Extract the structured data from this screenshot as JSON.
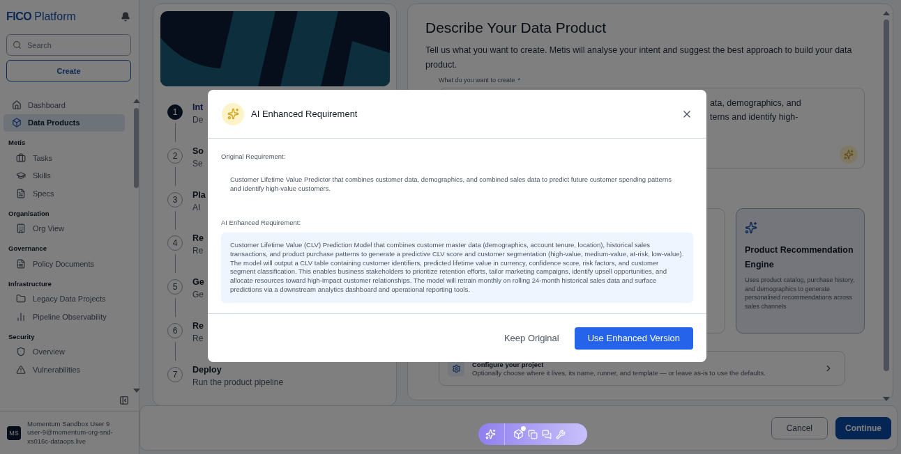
{
  "sidebar": {
    "logo": {
      "brand": "FICO",
      "product": "Platform"
    },
    "search": {
      "placeholder": "Search"
    },
    "create_button": "Create",
    "sections": [
      {
        "items": [
          {
            "label": "Dashboard",
            "selected": false
          },
          {
            "label": "Data Products",
            "selected": true
          }
        ]
      },
      {
        "heading": "Metis",
        "items": [
          {
            "label": "Tasks",
            "selected": false
          },
          {
            "label": "Skills",
            "selected": false
          },
          {
            "label": "Specs",
            "selected": false
          }
        ]
      },
      {
        "heading": "Organisation",
        "items": [
          {
            "label": "Org View",
            "selected": false
          }
        ]
      },
      {
        "heading": "Governance",
        "items": [
          {
            "label": "Policy Documents",
            "selected": false
          }
        ]
      },
      {
        "heading": "Infrastructure",
        "items": [
          {
            "label": "Legacy Data Projects",
            "selected": false
          },
          {
            "label": "Pipeline Observability",
            "selected": false
          }
        ]
      },
      {
        "heading": "Security",
        "items": [
          {
            "label": "Overview",
            "selected": false
          },
          {
            "label": "Vulnerabilities",
            "selected": false
          }
        ]
      }
    ],
    "user": {
      "initials": "MS",
      "name": "Momentum Sandbox User 9",
      "email": "user-9@momentum-org-snd-xs016c-dataops.live"
    }
  },
  "steps": [
    {
      "number": "1",
      "title": "Int",
      "subtitle": "De",
      "selected": true
    },
    {
      "number": "2",
      "title": "So",
      "subtitle": "Se",
      "selected": false
    },
    {
      "number": "3",
      "title": "Pla",
      "subtitle": "AI",
      "selected": false
    },
    {
      "number": "4",
      "title": "Re",
      "subtitle": "Re",
      "selected": false
    },
    {
      "number": "5",
      "title": "Ge",
      "subtitle": "Ge",
      "selected": false
    },
    {
      "number": "6",
      "title": "Re",
      "subtitle": "Re",
      "selected": false
    },
    {
      "number": "7",
      "title": "Deploy",
      "subtitle": "Run the product pipeline",
      "selected": false
    }
  ],
  "page": {
    "title": "Describe Your Data Product",
    "description": "Tell us what you want to create. Metis will analyse your intent and suggest the best approach to build your data product.",
    "field": {
      "label": "What do you want to create",
      "required_mark": "*",
      "visible_lines": [
        "ata, demographics, and",
        "terns and identify high-"
      ]
    },
    "cards": [
      {
        "title": "Product Recommendation Engine",
        "description": "Uses product catalog, purchase history, and demographics to generate personalised recommendations across sales channels"
      }
    ],
    "configure": {
      "title": "Configure your project",
      "description": "Optionally choose where it lives, its name, runner, and template — or leave as-is to use the defaults."
    }
  },
  "footer": {
    "buttons": [
      {
        "label": "Cancel",
        "kind": "secondary"
      },
      {
        "label": "Continue",
        "kind": "primary"
      }
    ]
  },
  "modal": {
    "title": "AI Enhanced Requirement",
    "sections": [
      {
        "kind": "plain",
        "label": "Original Requirement:",
        "text": "Customer Lifetime Value Predictor that combines customer data, demographics, and combined sales data to predict future customer spending patterns and identify high-value customers."
      },
      {
        "kind": "highlight",
        "label": "AI Enhanced Requirement:",
        "text": "Customer Lifetime Value (CLV) Prediction Model that combines customer master data (demographics, account tenure, location), historical sales transactions, and product purchase patterns to generate a predictive CLV score and customer segmentation (high-value, medium-value, at-risk, low-value). The model will output a CLV table containing customer identifiers, predicted lifetime value in currency, confidence score, risk factors, and customer segment classification. This enables business stakeholders to prioritize retention efforts, tailor marketing campaigns, identify upsell opportunities, and allocate resources toward high-impact customer relationships. The model will retrain monthly on rolling 24-month historical sales data and surface predictions via a downstream analytics dashboard and operational reporting tools."
      }
    ],
    "buttons": [
      {
        "label": "Keep Original",
        "kind": "text"
      },
      {
        "label": "Use Enhanced Version",
        "kind": "primary"
      }
    ]
  },
  "assistant_bar": {
    "notification_dot": true
  }
}
